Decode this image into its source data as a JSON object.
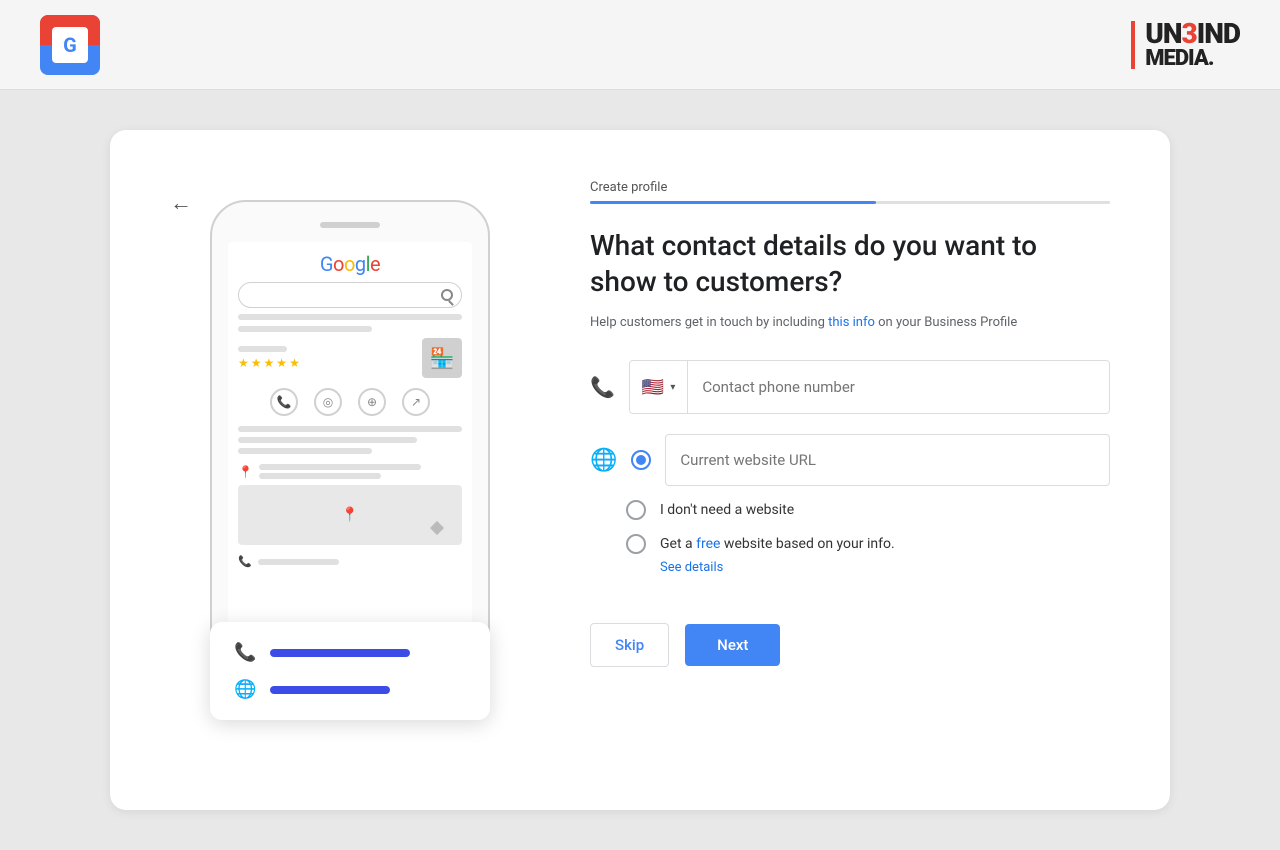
{
  "topbar": {
    "brand_name_un": "UN",
    "brand_name_3": "3",
    "brand_name_bind": "IND",
    "brand_name_media": "MEDIA",
    "brand_dot": "."
  },
  "form": {
    "step_label": "Create profile",
    "progress_pct": 55,
    "title": "What contact details do you want to show to customers?",
    "subtitle": "Help customers get in touch by including this info on your Business Profile",
    "phone_placeholder": "Contact phone number",
    "website_placeholder": "Current website URL",
    "no_website_label": "I don't need a website",
    "free_website_label": "Get a ",
    "free_website_link": "free",
    "free_website_suffix": " website based on your info.",
    "see_details_label": "See details",
    "skip_label": "Skip",
    "next_label": "Next",
    "subtitle_link": "this info"
  },
  "phone_section": {
    "country_flag": "🇺🇸",
    "dropdown_arrow": "▾"
  },
  "icons": {
    "back_arrow": "←",
    "phone": "📞",
    "globe": "🌐",
    "search": "🔍"
  }
}
